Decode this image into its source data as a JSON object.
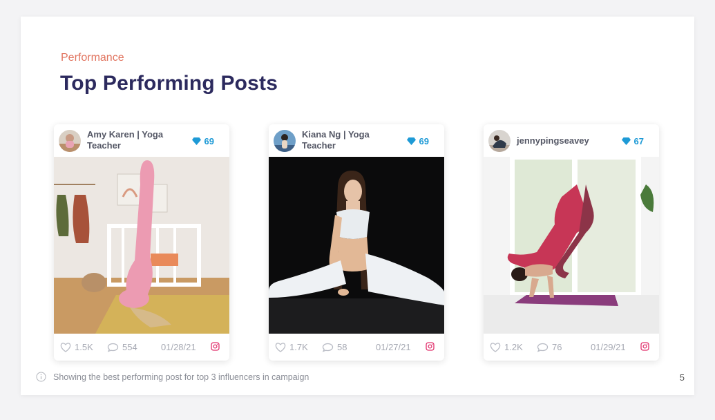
{
  "header": {
    "eyebrow": "Performance",
    "title": "Top Performing Posts"
  },
  "posts": [
    {
      "handle": "Amy Karen | Yoga Teacher",
      "score": "69",
      "likes": "1.5K",
      "comments": "554",
      "date": "01/28/21"
    },
    {
      "handle": "Kiana Ng | Yoga Teacher",
      "score": "69",
      "likes": "1.7K",
      "comments": "58",
      "date": "01/27/21"
    },
    {
      "handle": "jennypingseavey",
      "score": "67",
      "likes": "1.2K",
      "comments": "76",
      "date": "01/29/21"
    }
  ],
  "footer": {
    "note": "Showing the best performing post for top 3 influencers in campaign",
    "page_number": "5"
  },
  "icons": {
    "score": "diamond-icon",
    "likes": "heart-icon",
    "comments": "comment-icon",
    "platform": "instagram-icon",
    "info": "info-icon"
  },
  "colors": {
    "eyebrow": "#e1745f",
    "title": "#2c2a5e",
    "score": "#1e9ad6",
    "instagram": "#e1306c"
  }
}
